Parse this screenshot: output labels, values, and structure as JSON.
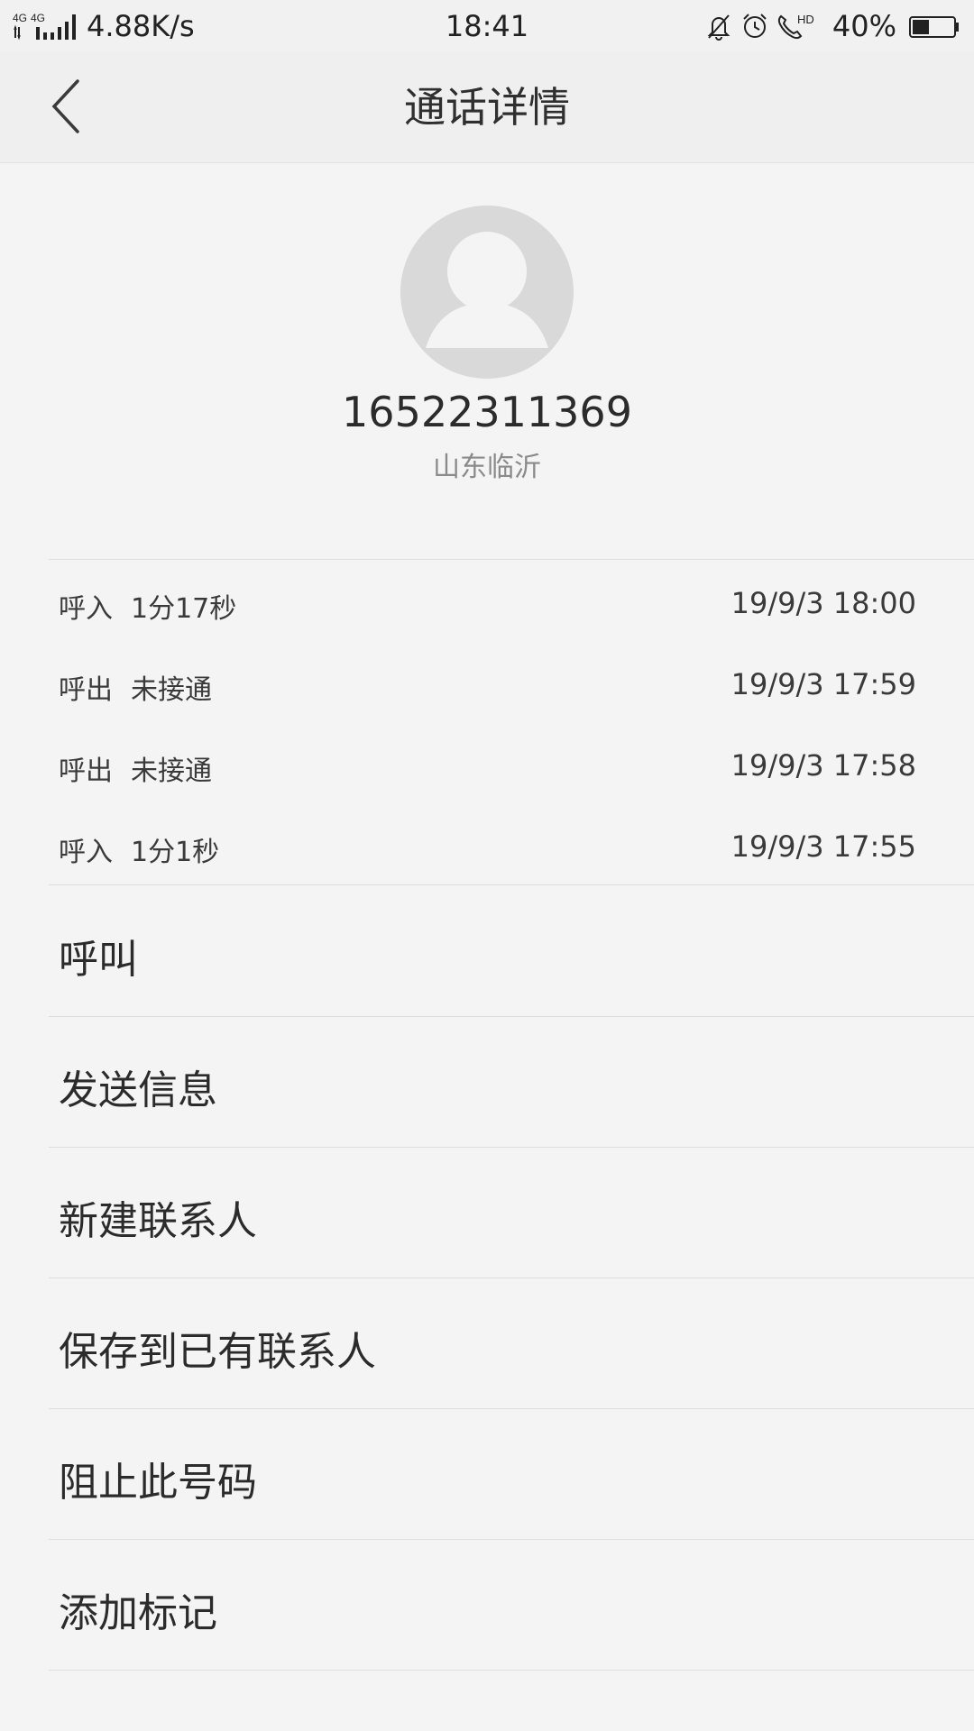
{
  "status_bar": {
    "network": "4G 4G",
    "speed": "4.88K/s",
    "time": "18:41",
    "battery": "40%",
    "battery_level": 0.4,
    "icons": [
      "mute-icon",
      "alarm-icon",
      "hd-call-icon",
      "battery-icon"
    ]
  },
  "header": {
    "title": "通话详情"
  },
  "contact": {
    "number": "16522311369",
    "location": "山东临沂"
  },
  "call_log": [
    {
      "type": "呼入",
      "detail": "1分17秒",
      "time": "19/9/3 18:00"
    },
    {
      "type": "呼出",
      "detail": "未接通",
      "time": "19/9/3 17:59"
    },
    {
      "type": "呼出",
      "detail": "未接通",
      "time": "19/9/3 17:58"
    },
    {
      "type": "呼入",
      "detail": "1分1秒",
      "time": "19/9/3 17:55"
    }
  ],
  "actions": [
    {
      "label": "呼叫"
    },
    {
      "label": "发送信息"
    },
    {
      "label": "新建联系人"
    },
    {
      "label": "保存到已有联系人"
    },
    {
      "label": "阻止此号码"
    },
    {
      "label": "添加标记"
    }
  ],
  "colors": {
    "background": "#f4f4f4",
    "header": "#efefef",
    "divider": "#dedede",
    "avatar": "#d9d9d9",
    "muted_text": "#8a8a8a"
  }
}
